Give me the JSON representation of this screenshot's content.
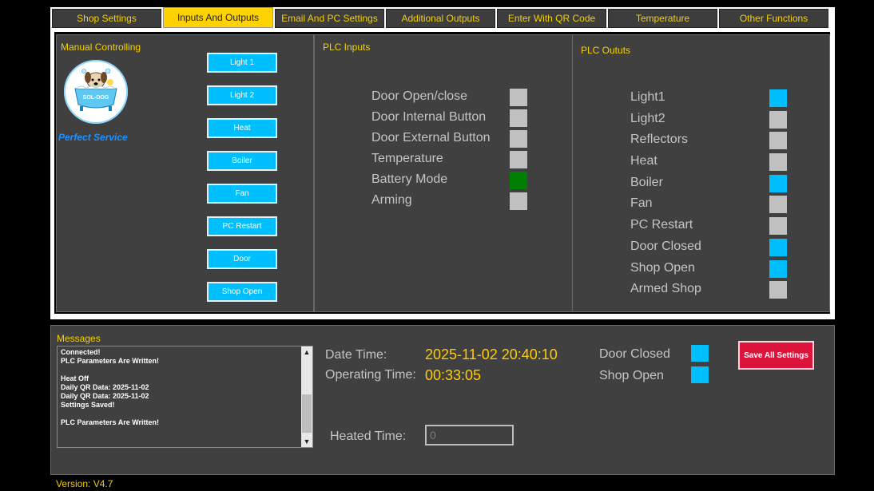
{
  "tabs": [
    {
      "label": "Shop Settings",
      "active": false
    },
    {
      "label": "Inputs And Outputs",
      "active": true
    },
    {
      "label": "Email And PC Settings",
      "active": false
    },
    {
      "label": "Additional Outputs",
      "active": false
    },
    {
      "label": "Enter With QR Code",
      "active": false
    },
    {
      "label": "Temperature",
      "active": false
    },
    {
      "label": "Other Functions",
      "active": false
    }
  ],
  "manual": {
    "title": "Manual Controlling",
    "logo_text": "SOL-DOG",
    "tagline": "Perfect Service",
    "buttons": [
      "Light 1",
      "Light 2",
      "Heat",
      "Boiler",
      "Fan",
      "PC Restart",
      "Door",
      "Shop Open"
    ]
  },
  "plc_inputs": {
    "title": "PLC Inputs",
    "items": [
      {
        "label": "Door Open/close",
        "color": "#c0c0c0"
      },
      {
        "label": "Door Internal Button",
        "color": "#c0c0c0"
      },
      {
        "label": "Door External Button",
        "color": "#c0c0c0"
      },
      {
        "label": "Temperature",
        "color": "#c0c0c0"
      },
      {
        "label": "Battery Mode",
        "color": "#008000"
      },
      {
        "label": "Arming",
        "color": "#c0c0c0"
      }
    ]
  },
  "plc_outputs": {
    "title": "PLC Oututs",
    "items": [
      {
        "label": "Light1",
        "color": "#00bfff"
      },
      {
        "label": "Light2",
        "color": "#c0c0c0"
      },
      {
        "label": "Reflectors",
        "color": "#c0c0c0"
      },
      {
        "label": "Heat",
        "color": "#c0c0c0"
      },
      {
        "label": "Boiler",
        "color": "#00bfff"
      },
      {
        "label": "Fan",
        "color": "#c0c0c0"
      },
      {
        "label": "PC Restart",
        "color": "#c0c0c0"
      },
      {
        "label": "Door Closed",
        "color": "#00bfff"
      },
      {
        "label": "Shop Open",
        "color": "#00bfff"
      },
      {
        "label": "Armed Shop",
        "color": "#c0c0c0"
      }
    ]
  },
  "messages": {
    "title": "Messages",
    "text": "Connected!\nPLC Parameters Are Written!\n\nHeat Off\nDaily QR Data: 2025-11-02\nDaily QR Data: 2025-11-02\nSettings Saved!\n\nPLC Parameters Are Written!"
  },
  "status": {
    "date_time_label": "Date  Time:",
    "date_time_value": "2025-11-02 20:40:10",
    "operating_time_label": "Operating Time:",
    "operating_time_value": "00:33:05",
    "door_closed_label": "Door Closed",
    "shop_open_label": "Shop Open",
    "heated_time_label": "Heated Time:",
    "heated_time_value": "0",
    "save_button": "Save All Settings"
  },
  "version": "Version: V4.7",
  "colors": {
    "accent_yellow": "#f4d000",
    "active_blue": "#00bfff",
    "inactive_gray": "#c0c0c0",
    "ok_green": "#008000",
    "save_red": "#dc143c"
  }
}
